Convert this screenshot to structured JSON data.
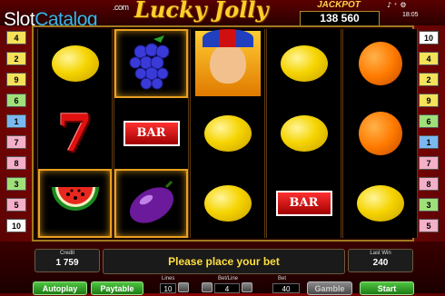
{
  "watermark": {
    "slot": "Slot",
    "catalog": "Catalog",
    "com": ".com"
  },
  "game_title": "Lucky Jolly",
  "jackpot": {
    "label": "JACKPOT",
    "value": "138 560"
  },
  "clock": "18:05",
  "reels": [
    [
      "lemon",
      "seven",
      "watermelon"
    ],
    [
      "grapes",
      "bar",
      "plum"
    ],
    [
      "joker",
      "lemon",
      "lemon"
    ],
    [
      "lemon",
      "lemon",
      "bar"
    ],
    [
      "orange",
      "orange",
      "lemon"
    ]
  ],
  "bar_label": "BAR",
  "left_lines": [
    {
      "n": "4",
      "c": "#f3e25a"
    },
    {
      "n": "2",
      "c": "#f3e25a"
    },
    {
      "n": "9",
      "c": "#f3e25a"
    },
    {
      "n": "6",
      "c": "#9fe07a"
    },
    {
      "n": "1",
      "c": "#7ab8f0"
    },
    {
      "n": "7",
      "c": "#f3b0c8"
    },
    {
      "n": "8",
      "c": "#f3b0c8"
    },
    {
      "n": "3",
      "c": "#9fe07a"
    },
    {
      "n": "5",
      "c": "#f3b0c8"
    },
    {
      "n": "10",
      "c": "#ffffff"
    }
  ],
  "right_lines": [
    {
      "n": "10",
      "c": "#ffffff"
    },
    {
      "n": "4",
      "c": "#f3e25a"
    },
    {
      "n": "2",
      "c": "#f3e25a"
    },
    {
      "n": "9",
      "c": "#f3e25a"
    },
    {
      "n": "6",
      "c": "#9fe07a"
    },
    {
      "n": "1",
      "c": "#7ab8f0"
    },
    {
      "n": "7",
      "c": "#f3b0c8"
    },
    {
      "n": "8",
      "c": "#f3b0c8"
    },
    {
      "n": "3",
      "c": "#9fe07a"
    },
    {
      "n": "5",
      "c": "#f3b0c8"
    }
  ],
  "credit": {
    "label": "Credit",
    "value": "1 759"
  },
  "last_win": {
    "label": "Last Win",
    "value": "240"
  },
  "message": "Please place your bet",
  "controls": {
    "autoplay": "Autoplay",
    "paytable": "Paytable",
    "lines_label": "Lines",
    "lines_value": "10",
    "bet_line_label": "Bet/Line",
    "bet_line_value": "4",
    "bet_label": "Bet",
    "bet_value": "40",
    "gamble": "Gamble",
    "start": "Start"
  }
}
